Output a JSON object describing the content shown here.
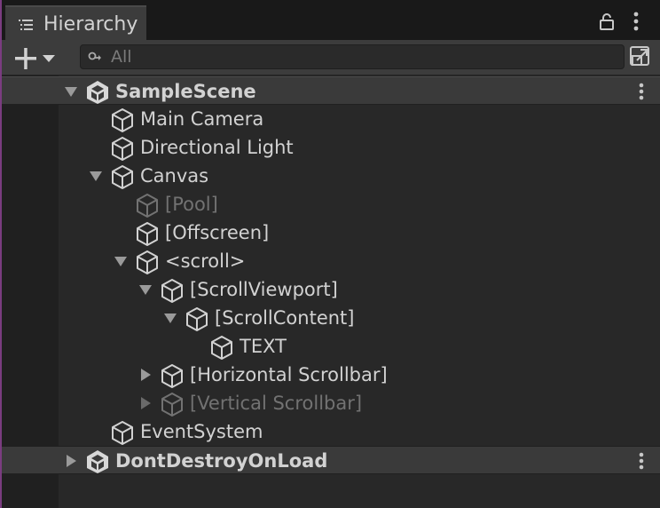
{
  "window": {
    "tab_title": "Hierarchy"
  },
  "toolbar": {
    "search_placeholder": "All",
    "search_value": ""
  },
  "icons": {
    "tab": "hierarchy-list-icon",
    "lock": "lock-icon",
    "menu": "kebab-menu-icon",
    "add": "plus-icon",
    "search": "search-icon",
    "select": "scene-pick-icon",
    "scene": "unity-scene-icon",
    "gameobject": "gameobject-cube-icon"
  },
  "colors": {
    "text": "#d2d2d2",
    "dim_text": "#727272",
    "scene_row": "#3a3a3a",
    "tab_bg": "#3c3c3c",
    "accent": "#7a3c80"
  },
  "hierarchy": {
    "rows": [
      {
        "label": "SampleScene",
        "type": "scene",
        "depth": 0,
        "expander": "expanded",
        "dim": false
      },
      {
        "label": "Main Camera",
        "type": "object",
        "depth": 1,
        "expander": "none",
        "dim": false
      },
      {
        "label": "Directional Light",
        "type": "object",
        "depth": 1,
        "expander": "none",
        "dim": false
      },
      {
        "label": "Canvas",
        "type": "object",
        "depth": 1,
        "expander": "expanded",
        "dim": false
      },
      {
        "label": "[Pool]",
        "type": "object",
        "depth": 2,
        "expander": "none",
        "dim": true
      },
      {
        "label": "[Offscreen]",
        "type": "object",
        "depth": 2,
        "expander": "none",
        "dim": false
      },
      {
        "label": "<scroll>",
        "type": "object",
        "depth": 2,
        "expander": "expanded",
        "dim": false
      },
      {
        "label": "[ScrollViewport]",
        "type": "object",
        "depth": 3,
        "expander": "expanded",
        "dim": false
      },
      {
        "label": "[ScrollContent]",
        "type": "object",
        "depth": 4,
        "expander": "expanded",
        "dim": false
      },
      {
        "label": "TEXT",
        "type": "object",
        "depth": 5,
        "expander": "none",
        "dim": false
      },
      {
        "label": "[Horizontal Scrollbar]",
        "type": "object",
        "depth": 3,
        "expander": "collapsed",
        "dim": false
      },
      {
        "label": "[Vertical Scrollbar]",
        "type": "object",
        "depth": 3,
        "expander": "collapsed",
        "dim": true
      },
      {
        "label": "EventSystem",
        "type": "object",
        "depth": 1,
        "expander": "none",
        "dim": false
      },
      {
        "label": "DontDestroyOnLoad",
        "type": "scene",
        "depth": 0,
        "expander": "collapsed",
        "dim": false
      }
    ]
  }
}
